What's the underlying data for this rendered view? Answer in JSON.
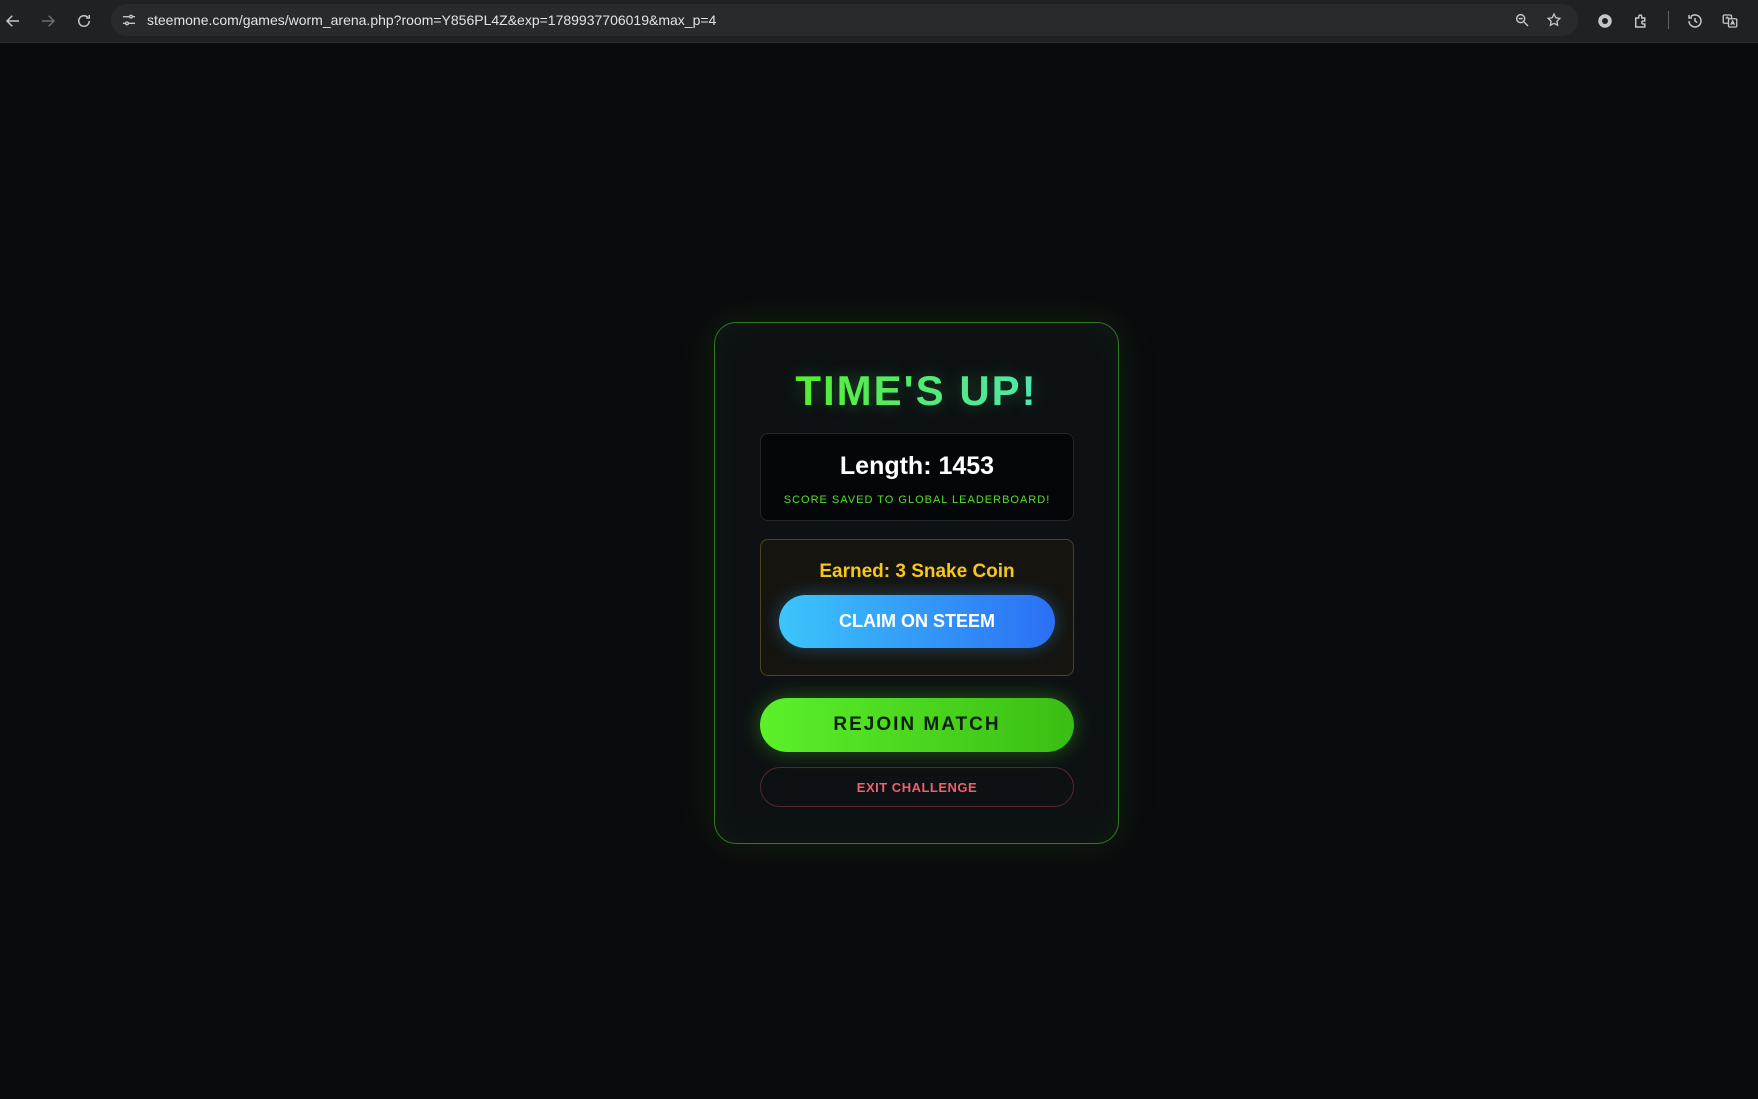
{
  "browser": {
    "url": "steemone.com/games/worm_arena.php?room=Y856PL4Z&exp=1789937706019&max_p=4",
    "icons": {
      "back": "arrow-left-icon",
      "forward": "arrow-right-icon",
      "reload": "reload-icon",
      "site_info": "tune-icon",
      "zoom": "magnifier-icon",
      "bookmark": "star-icon",
      "extension_one": "extension-icon",
      "extensions": "puzzle-icon",
      "history": "history-icon",
      "translate": "translate-icon"
    }
  },
  "game_over": {
    "title": "TIME'S UP!",
    "length_text": "Length: 1453",
    "saved_text": "SCORE SAVED TO GLOBAL LEADERBOARD!",
    "earned_text": "Earned: 3 Snake Coin",
    "claim_label": "CLAIM ON STEEM",
    "rejoin_label": "REJOIN MATCH",
    "exit_label": "EXIT CHALLENGE"
  },
  "colors": {
    "background": "#0a0b0d",
    "card_border": "#2f7a22",
    "accent_green": "#57f02a",
    "accent_teal": "#4fe6b8",
    "coin_gold": "#f4c81a",
    "claim_blue": "#2b6ff5",
    "exit_red": "#f0606a"
  }
}
